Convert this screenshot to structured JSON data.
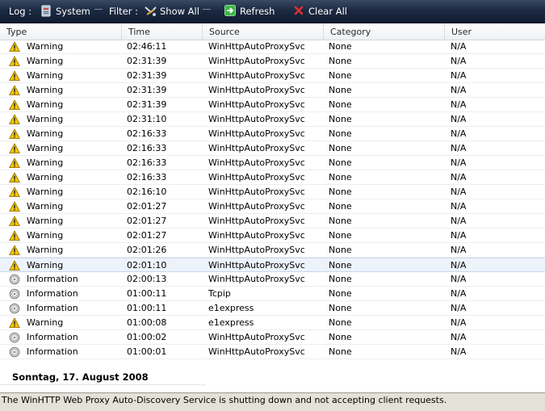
{
  "toolbar": {
    "log_label": "Log :",
    "log_value": "System",
    "filter_label": "Filter :",
    "filter_value": "Show All",
    "refresh_label": "Refresh",
    "clear_label": "Clear All"
  },
  "columns": [
    "Type",
    "Time",
    "Source",
    "Category",
    "User"
  ],
  "rows": [
    {
      "type": "Warning",
      "time": "02:46:11",
      "source": "WinHttpAutoProxySvc",
      "category": "None",
      "user": "N/A",
      "icon": "warning-icon"
    },
    {
      "type": "Warning",
      "time": "02:31:39",
      "source": "WinHttpAutoProxySvc",
      "category": "None",
      "user": "N/A",
      "icon": "warning-icon"
    },
    {
      "type": "Warning",
      "time": "02:31:39",
      "source": "WinHttpAutoProxySvc",
      "category": "None",
      "user": "N/A",
      "icon": "warning-icon"
    },
    {
      "type": "Warning",
      "time": "02:31:39",
      "source": "WinHttpAutoProxySvc",
      "category": "None",
      "user": "N/A",
      "icon": "warning-icon"
    },
    {
      "type": "Warning",
      "time": "02:31:39",
      "source": "WinHttpAutoProxySvc",
      "category": "None",
      "user": "N/A",
      "icon": "warning-icon"
    },
    {
      "type": "Warning",
      "time": "02:31:10",
      "source": "WinHttpAutoProxySvc",
      "category": "None",
      "user": "N/A",
      "icon": "warning-icon"
    },
    {
      "type": "Warning",
      "time": "02:16:33",
      "source": "WinHttpAutoProxySvc",
      "category": "None",
      "user": "N/A",
      "icon": "warning-icon"
    },
    {
      "type": "Warning",
      "time": "02:16:33",
      "source": "WinHttpAutoProxySvc",
      "category": "None",
      "user": "N/A",
      "icon": "warning-icon"
    },
    {
      "type": "Warning",
      "time": "02:16:33",
      "source": "WinHttpAutoProxySvc",
      "category": "None",
      "user": "N/A",
      "icon": "warning-icon"
    },
    {
      "type": "Warning",
      "time": "02:16:33",
      "source": "WinHttpAutoProxySvc",
      "category": "None",
      "user": "N/A",
      "icon": "warning-icon"
    },
    {
      "type": "Warning",
      "time": "02:16:10",
      "source": "WinHttpAutoProxySvc",
      "category": "None",
      "user": "N/A",
      "icon": "warning-icon"
    },
    {
      "type": "Warning",
      "time": "02:01:27",
      "source": "WinHttpAutoProxySvc",
      "category": "None",
      "user": "N/A",
      "icon": "warning-icon"
    },
    {
      "type": "Warning",
      "time": "02:01:27",
      "source": "WinHttpAutoProxySvc",
      "category": "None",
      "user": "N/A",
      "icon": "warning-icon"
    },
    {
      "type": "Warning",
      "time": "02:01:27",
      "source": "WinHttpAutoProxySvc",
      "category": "None",
      "user": "N/A",
      "icon": "warning-icon"
    },
    {
      "type": "Warning",
      "time": "02:01:26",
      "source": "WinHttpAutoProxySvc",
      "category": "None",
      "user": "N/A",
      "icon": "warning-icon"
    },
    {
      "type": "Warning",
      "time": "02:01:10",
      "source": "WinHttpAutoProxySvc",
      "category": "None",
      "user": "N/A",
      "icon": "warning-icon",
      "selected": true
    },
    {
      "type": "Information",
      "time": "02:00:13",
      "source": "WinHttpAutoProxySvc",
      "category": "None",
      "user": "N/A",
      "icon": "information-icon"
    },
    {
      "type": "Information",
      "time": "01:00:11",
      "source": "Tcpip",
      "category": "None",
      "user": "N/A",
      "icon": "information-icon"
    },
    {
      "type": "Information",
      "time": "01:00:11",
      "source": "e1express",
      "category": "None",
      "user": "N/A",
      "icon": "information-icon"
    },
    {
      "type": "Warning",
      "time": "01:00:08",
      "source": "e1express",
      "category": "None",
      "user": "N/A",
      "icon": "warning-icon"
    },
    {
      "type": "Information",
      "time": "01:00:02",
      "source": "WinHttpAutoProxySvc",
      "category": "None",
      "user": "N/A",
      "icon": "information-icon"
    },
    {
      "type": "Information",
      "time": "01:00:01",
      "source": "WinHttpAutoProxySvc",
      "category": "None",
      "user": "N/A",
      "icon": "information-icon"
    }
  ],
  "date_group": "Sonntag, 17. August 2008",
  "status_text": "The WinHTTP Web Proxy Auto-Discovery Service is shutting down and not accepting client requests.",
  "colors": {
    "toolbar_bg": "#1c2a42",
    "selected_row": "#edf3fb",
    "warning_yellow": "#f5c400",
    "status_bg": "#e4e2d8"
  }
}
